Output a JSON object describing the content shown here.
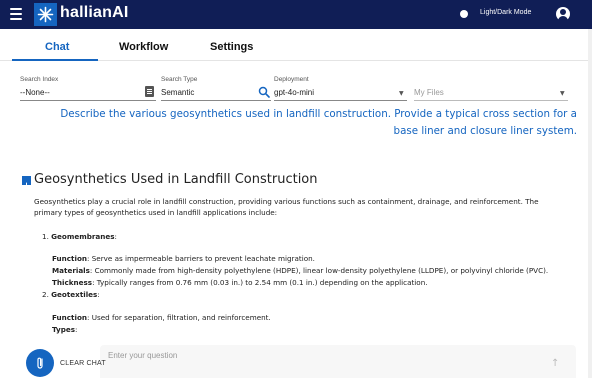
{
  "header": {
    "brand_name": "hallianAI",
    "mode_label": "Light/Dark Mode",
    "colors": {
      "bar": "#101e56",
      "accent": "#1565c0"
    }
  },
  "tabs": [
    {
      "label": "Chat",
      "active": true
    },
    {
      "label": "Workflow",
      "active": false
    },
    {
      "label": "Settings",
      "active": false
    }
  ],
  "controls": {
    "search_index": {
      "label": "Search Index",
      "value": "--None--"
    },
    "search_type": {
      "label": "Search Type",
      "value": "Semantic"
    },
    "deployment": {
      "label": "Deployment",
      "value": "gpt-4o-mini"
    },
    "my_files": {
      "placeholder": "My Files"
    }
  },
  "question": "Describe the various geosynthetics used in landfill construction. Provide a typical cross section for a base liner and closure liner system.",
  "answer": {
    "title": "Geosynthetics Used in Landfill Construction",
    "intro": "Geosynthetics play a crucial role in landfill construction, providing various functions such as containment, drainage, and reinforcement. The primary types of geosynthetics used in landfill applications include:",
    "items": [
      {
        "number": "1.",
        "heading": "Geomembranes",
        "suffix": ":",
        "details": [
          {
            "key": "Function",
            "text": ": Serve as impermeable barriers to prevent leachate migration."
          },
          {
            "key": "Materials",
            "text": ": Commonly made from high-density polyethylene (HDPE), linear low-density polyethylene (LLDPE), or polyvinyl chloride (PVC)."
          },
          {
            "key": "Thickness",
            "text": ": Typically ranges from 0.76 mm (0.03 in.) to 2.54 mm (0.1 in.) depending on the application."
          }
        ]
      },
      {
        "number": "2.",
        "heading": "Geotextiles",
        "suffix": ":",
        "details": [
          {
            "key": "Function",
            "text": ": Used for separation, filtration, and reinforcement."
          },
          {
            "key": "Types",
            "text": ":"
          }
        ]
      }
    ]
  },
  "footer": {
    "clear_label": "CLEAR CHAT",
    "input_placeholder": "Enter your question"
  }
}
